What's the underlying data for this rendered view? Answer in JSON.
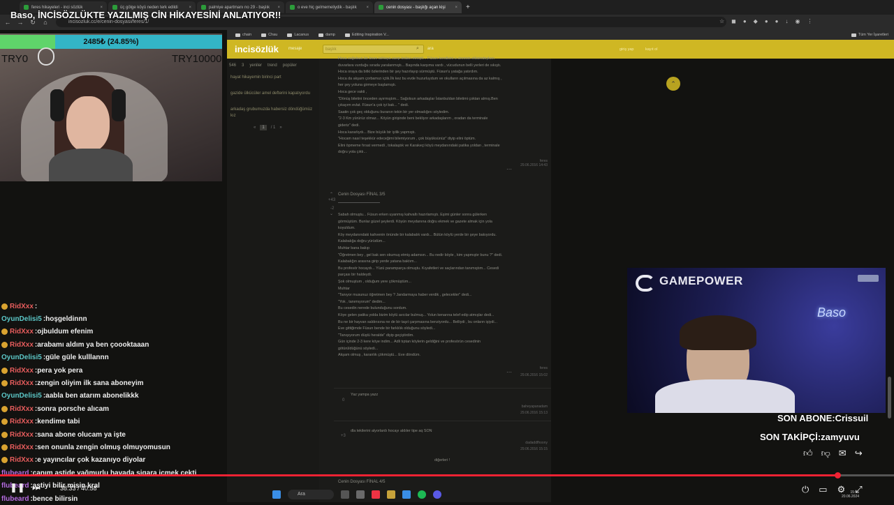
{
  "overlay_title": "Baso, İNCİSÖZLÜKTE YAZILMIŞ CİN HİKAYESİNİ ANLATIYOR!!",
  "browser": {
    "tabs": [
      {
        "label": "feres hikayeleri - inci sözlük",
        "active": false
      },
      {
        "label": "üç gölge köyü neden terk edildi",
        "active": false
      },
      {
        "label": "palmiye apartmanı no 29 - başlık",
        "active": false
      },
      {
        "label": "o eve hiç gelmemeliydik - başlık",
        "active": false
      },
      {
        "label": "cenin dosyası - başlığı açan kişi",
        "active": true
      }
    ],
    "new_tab": "+",
    "url": "incisozluk.cc/e/cenin-dosyasi/feres/1/",
    "bookmarks": [
      "chain",
      "Chau",
      "Lacanus",
      "damp",
      "Editing Inspiration V...",
      "Tüm Yer İşaretleri"
    ]
  },
  "site": {
    "logo": "incisözlük",
    "mesaj": "mesaje",
    "search_placeholder": "başlık",
    "ara": "ara",
    "giris": "giriş yap",
    "kayit": "kayıt ol",
    "subtabs": [
      "546",
      "3",
      "yeniler",
      "trend",
      "popüler"
    ],
    "left_links": [
      "hayat hikayemin birinci part",
      "gazide ülkücüler amel defterini kapatıyordu",
      "arkadaş grubumuzda habersiz döndüğümüz kız"
    ],
    "pager": {
      "current": "1",
      "total": "/ 1"
    },
    "entries": [
      {
        "lines": [
          "Hoca sağolsun bir beze tahtaya sarıp tedavi etmişti... Füsun kendisini o cinninin etkisindeyken",
          "duvarlara vurduğu sırada yaralanmıştı... Başında karşıma vardı , vücudunun belli yerleri de sıkıştı.",
          "Hoca oraya da bitki özlerinden bir şey hazırlayıp sürmüştü. Füsun'u yatağa yatırdım.",
          "Hoca da akşam çorbamızı içtik.İlk kez bu evde huzurluydum ve okulların açılmasına da az kalmış ,",
          "her şey yoluna girmeye başlamıştı.",
          "Hoca gece vakti ,",
          "\"Dönüş biletini önceden ayırmıştım... Sağolsun arkadaşlar İstanbuldan biletimi çoktan almış.Ben",
          "çıkayım evlat. Füsun'a çok iyi bak... \" dedi.",
          "Saatin çok geç olduğunu buranın tekin bir yer olmadığını söyledim.",
          "\"2-3 Km yürürüz olmaz... Köyün girişinde beni bekliyor arkadaşlarım , oradan da terminale",
          "gideriz\" dedi.",
          "Hoca kararlıydı... Bize büyük bir iyilik yapmıştı.",
          "\"Hocam nasıl teşekkür edeceğimi bilemiyorum , çok büyüksünüz\" diyip elini öptüm.",
          "Elini öpmeme fırsat vermedi , tokalaştık ve Karakeçi köyü meydanındaki patika yoldan , terminale",
          "doğru yola çıktı..."
        ],
        "author": "feres",
        "date": "29.06.2016 14:43"
      },
      {
        "title": "Cenin Dosyası FİNAL 3/5",
        "votes_up": "+43",
        "votes_down": "-2",
        "lines": [
          "Sabah olmuştu... Füsun erken uyanmış kahvaltı hazırlamıştı. Eşimi günler sonra gülerken",
          "görmüştüm. Bunlar güzel şeylerdi. Köyün meydanına doğru ekmek ve gazete almak için yola",
          "koyuldum.",
          "Köy meydanındaki kahvenin önünde bir kalabalık vardı... Bütün köylü yerde bir şeye bakıyordu.",
          "Kalabalığa doğru yürüdüm...",
          "Muhtar bana bakıp",
          "\"Öğretmen bey , gel bak sen okumuş etmiş adamsın... Bu nedir böyle , kim yapmıştır bunu ?\" dedi.",
          "Kalabalığın arasına girip yerde yatana baktım...",
          "Bu profesör hocaydı... Yüzü paramparça olmuştu. Kıyafetleri ve saçlarından tanımıştım... Cesedi",
          "parçası bir haldeydi.",
          "Şok olmuştum , olduğum yere çökmüştüm...",
          "Muhtar",
          "\"Tanıyor musunuz öğretmen bey ? Jandarmaya haber verdik , gelecekler\" dedi...",
          "\"Yok , tanımıyorum\" dedim...",
          "Bu cesedin nerede bulunduğunu sordum.",
          "Köye gelen patika yolda bizim köylü avcılar bulmuş... Yolun kenarına telef edip atmışlar dedi...",
          "Bu ne bir hayvan saldırısına ne de bir taşıt çarpmasına benziyordu... Belliydi , bu onların işiydi...",
          "Eve gittiğimde Füsun bende bir farklılık olduğunu söyledi...",
          "\"Tanışıyorum düştü heralde\" diyip geçiştirdim.",
          "Gün içinde 2-3 kere köye indim... Adli tıptan köylerin geldiğini ve profesörün cesedinin",
          "götürüldüğünü söyledi...",
          "Akşam olmuş , karanlık çökmüştü... Eve döndüm."
        ],
        "author": "feres",
        "date": "29.06.2016 15:02"
      }
    ],
    "replies": [
      {
        "text": "Yaz yampa yazz",
        "score": "0",
        "author": "baheyapanadam",
        "date": "29.06.2016 15:13"
      },
      {
        "text": "dla tekilerini alyorlardı hocayı aldıler tipe aq SON",
        "score": "+3",
        "author": "dadaddfhoony",
        "date": "29.06.2016 15:15"
      }
    ],
    "more_replies": "diğerleri !",
    "next_title": "Cenin Dosyası FİNAL 4/5"
  },
  "goal": {
    "text": "2485₺ (24.85%)",
    "percent": 24.85,
    "min": "TRY0",
    "max": "TRY10000"
  },
  "cam2_logo": "GAMEPOWER",
  "cam2_neon": "Baso",
  "chat": [
    {
      "user": "RidXxx",
      "msg": "",
      "badge": true,
      "color": "#e85d5d"
    },
    {
      "user": "OyunDelisi5",
      "msg": "hoşgeldinnn",
      "badge": false,
      "color": "#5cc8c8"
    },
    {
      "user": "RidXxx",
      "msg": "ojbuldum efenim",
      "badge": true,
      "color": "#e85d5d"
    },
    {
      "user": "RidXxx",
      "msg": "arabamı aldım ya ben çoooktaaan",
      "badge": true,
      "color": "#e85d5d"
    },
    {
      "user": "OyunDelisi5",
      "msg": "güle güle kulllannn",
      "badge": false,
      "color": "#5cc8c8"
    },
    {
      "user": "RidXxx",
      "msg": "pera yok pera",
      "badge": true,
      "color": "#e85d5d"
    },
    {
      "user": "RidXxx",
      "msg": "zengin oliyim ilk sana aboneyim",
      "badge": true,
      "color": "#e85d5d"
    },
    {
      "user": "OyunDelisi5",
      "msg": "aabla ben atarım abonelikkk",
      "badge": false,
      "color": "#5cc8c8"
    },
    {
      "user": "RidXxx",
      "msg": "sonra porsche alıcam",
      "badge": true,
      "color": "#e85d5d"
    },
    {
      "user": "RidXxx",
      "msg": "kendime tabi",
      "badge": true,
      "color": "#e85d5d"
    },
    {
      "user": "RidXxx",
      "msg": "sana abone olucam ya işte",
      "badge": true,
      "color": "#e85d5d"
    },
    {
      "user": "RidXxx",
      "msg": "sen onunla zengin olmuş olmuyomusun",
      "badge": true,
      "color": "#e85d5d"
    },
    {
      "user": "RidXxx",
      "msg": "e yayıncılar çok kazanıyo diyolar",
      "badge": true,
      "color": "#e85d5d"
    },
    {
      "user": "flubeard",
      "msg": "canım aştide yağmurlu havada sigara içmek çekti",
      "badge": false,
      "color": "#b56be0"
    },
    {
      "user": "flubeard",
      "msg": "aştiyi bilir misin kral",
      "badge": false,
      "color": "#b56be0"
    },
    {
      "user": "flubeard",
      "msg": "bence bilirsin",
      "badge": false,
      "color": "#b56be0"
    }
  ],
  "son_abone": "SON ABONE:Crissuil",
  "son_takipci": "SON TAKİPÇİ:zamyuvu",
  "player": {
    "time": "38:33 / 40:58",
    "progress": 0.937
  },
  "taskbar": {
    "search": "Ara"
  },
  "clock": {
    "time": "15:55",
    "date": "20.06.2024"
  },
  "colors": {
    "site_yellow": "#cfb723",
    "progress_red": "#e22233",
    "goal_cyan": "#33b5c6",
    "goal_green": "#5fd46a"
  }
}
